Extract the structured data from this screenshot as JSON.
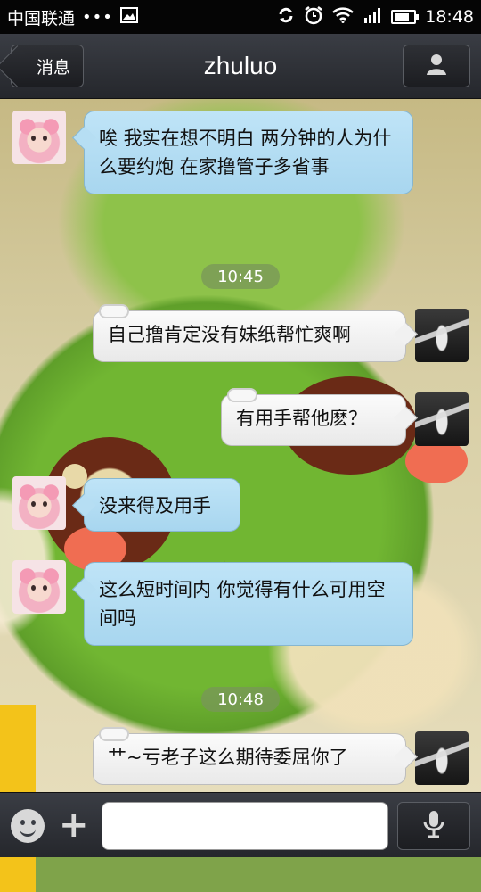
{
  "status_bar": {
    "carrier": "中国联通",
    "dots": "•••",
    "time": "18:48",
    "icons": [
      "image-icon",
      "sync-icon",
      "alarm-icon",
      "wifi-icon",
      "signal-icon",
      "battery-icon"
    ]
  },
  "header": {
    "back_label": "消息",
    "title": "zhuluo",
    "profile_icon": "person-icon"
  },
  "messages": [
    {
      "side": "in",
      "text": "唉 我实在想不明白 两分钟的人为什么要约炮 在家撸管子多省事",
      "avatar": "girl-avatar"
    },
    {
      "type": "time",
      "text": "10:45"
    },
    {
      "side": "out",
      "text": "自己撸肯定没有妹纸帮忙爽啊",
      "avatar": "photo-avatar"
    },
    {
      "side": "out",
      "text": "有用手帮他麽？",
      "avatar": "photo-avatar"
    },
    {
      "side": "in",
      "text": "没来得及用手",
      "avatar": "girl-avatar"
    },
    {
      "side": "in",
      "text": "这么短时间内 你觉得有什么可用空间吗",
      "avatar": "girl-avatar"
    },
    {
      "type": "time",
      "text": "10:48"
    },
    {
      "side": "out",
      "text": "艹~亏老子这么期待委屈你了",
      "avatar": "photo-avatar"
    }
  ],
  "input_bar": {
    "emoji_icon": "emoji-icon",
    "plus_icon": "plus-icon",
    "input_value": "",
    "voice_icon": "microphone-icon"
  },
  "colors": {
    "incoming_bubble": "#a8d6ef",
    "outgoing_bubble": "#f1f1f1",
    "bar": "#25272c"
  }
}
